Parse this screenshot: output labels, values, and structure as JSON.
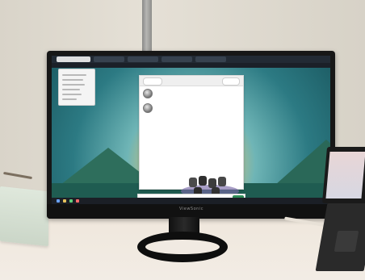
{
  "scene": {
    "monitor_brand": "ViewSonic",
    "device": "monitor"
  },
  "browser": {
    "tabs": [
      {
        "label": "",
        "active": true
      },
      {
        "label": "",
        "active": false
      },
      {
        "label": "",
        "active": false
      },
      {
        "label": "",
        "active": false
      },
      {
        "label": "",
        "active": false
      }
    ],
    "left_panel_lines": 6
  },
  "chat": {
    "title": "",
    "back_label": "",
    "close_label": "",
    "messages": [
      "",
      "",
      "",
      ""
    ],
    "input_placeholder": ""
  },
  "colors": {
    "screen_accent": "#2a7f8f",
    "sun": "#f6d36b",
    "ui_green": "#2e8b57"
  }
}
